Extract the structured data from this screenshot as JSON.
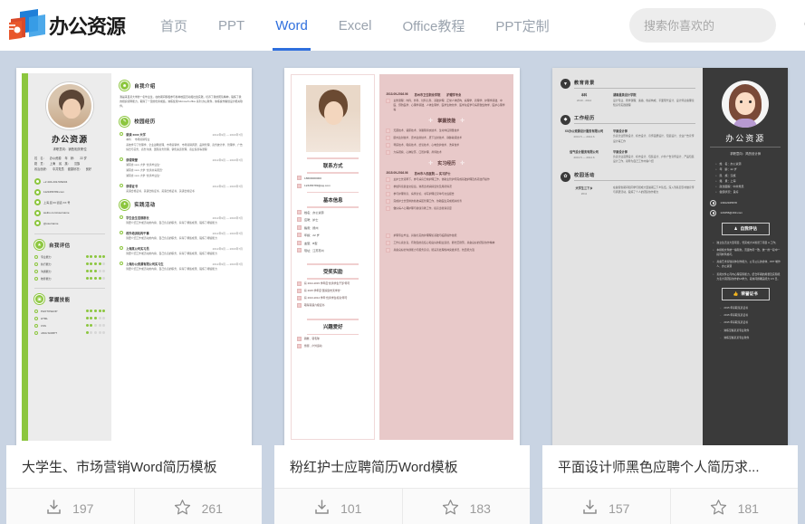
{
  "header": {
    "logo_text": "办公资源",
    "nav": [
      {
        "label": "首页",
        "active": false
      },
      {
        "label": "PPT",
        "active": false
      },
      {
        "label": "Word",
        "active": true
      },
      {
        "label": "Excel",
        "active": false
      },
      {
        "label": "Office教程",
        "active": false
      },
      {
        "label": "PPT定制",
        "active": false
      }
    ],
    "search": {
      "placeholder": "搜索你喜欢的",
      "value": "",
      "icon": "search-icon"
    },
    "accent_color": "#2f6fdd",
    "nav_inactive_color": "#9aa3ae"
  },
  "cards": [
    {
      "title": "大学生、市场营销Word简历模板",
      "downloads": "197",
      "favorites": "261",
      "download_icon": "download-icon",
      "favorite_icon": "star-icon"
    },
    {
      "title": "粉红护士应聘简历Word模板",
      "downloads": "101",
      "favorites": "183",
      "download_icon": "download-icon",
      "favorite_icon": "star-icon"
    },
    {
      "title": "平面设计师黑色应聘个人简历求...",
      "downloads": "157",
      "favorites": "181",
      "download_icon": "download-icon",
      "favorite_icon": "star-icon"
    }
  ],
  "resume1": {
    "accent_color": "#8cc63e",
    "name": "办公资源",
    "objective": "求职意向：销售相关职位",
    "info": [
      {
        "k": "姓　名：",
        "v": "办公资源"
      },
      {
        "k": "年　龄：",
        "v": "22 岁"
      },
      {
        "k": "籍　贯：",
        "v": "上海"
      },
      {
        "k": "民　族：",
        "v": "汉族"
      },
      {
        "k": "政治面貌：",
        "v": "中共党员"
      },
      {
        "k": "健康状况：",
        "v": "良好"
      }
    ],
    "contacts": [
      "+2 434-232-539234",
      "1123456789.com",
      "上海,区XX 街道 XX 号",
      "weibo.com/username",
      "@username"
    ],
    "sections": {
      "intro_title": "自我介绍",
      "intro_text": "我是来自某大学的一名毕业生，在校期间积极参与各种校园活动和社会实践，培养了我的团队精神，锻炼了我的组织领导能力，取得了一定的优秀成绩，熟练使用 Microsoft office 系列 办公软件，熟练操作策划设计相关软件。",
      "campus_title": "校园经历",
      "campus": [
        {
          "org": "就读 xxxx 大学",
          "date": "2012年9月 — 2016年7月",
          "major": "本科",
          "major2": "市场营销专业",
          "desc": "系统学习了管理学、企业战略管理、市场营销学、市场营销调研、品牌管理、商务统计学、管理学、广告综合与实务、商务沟通、国际商务管理、销售渠道管理、商业贸易等课程"
        },
        {
          "org": "获得荣誉",
          "date": "2012年9月 — 2016年7月",
          "list": [
            "湖南省 xxxx 大学 “优秀毕业生”",
            "湖南省 xxxx 大学 “优秀共青团员”",
            "湖南省 xxxx 大学 “优秀毕业生”"
          ]
        },
        {
          "org": "获得证书",
          "date": "2012年9月 — 2016年7月",
          "list": [
            "英语合格证书、英语合格证书、英语合格证书、英语合格证书"
          ]
        }
      ],
      "activity_title": "实践活动",
      "activities": [
        {
          "t": "学生会生活部部长",
          "d": "2012年9月 — 2016年7月",
          "p": "简要介绍工作或活动的内容、自己负责的职务、获得了哪些成果、锻炼了哪些能力"
        },
        {
          "t": "校外培训机构干事",
          "d": "2012年9月 — 2016年7月",
          "p": "简要介绍工作或活动的内容、自己负责的职务、获得了哪些成果、锻炼了哪些能力"
        },
        {
          "t": "上海某公司实习员",
          "d": "2012年9月 — 2016年7月",
          "p": "简要介绍工作或活动的内容、自己负责的职务、获得了哪些成果、锻炼了哪些能力"
        },
        {
          "t": "上海办公资源有限公司实习生",
          "d": "2012年9月 — 2016年7月",
          "p": "简要介绍工作或活动的内容、自己负责的职务、获得了哪些成果、锻炼了哪些能力"
        }
      ],
      "assess_title": "自我评估",
      "assess": [
        {
          "label": "专业能力",
          "level": 5
        },
        {
          "label": "执行能力",
          "level": 4
        },
        {
          "label": "沟通能力",
          "level": 3
        },
        {
          "label": "统筹能力",
          "level": 4
        }
      ],
      "skill_title": "掌握技能",
      "skills": [
        {
          "label": "PHOTOSHOP",
          "level": 5
        },
        {
          "label": "HTML",
          "level": 3
        },
        {
          "label": "CSS",
          "level": 2
        },
        {
          "label": "JAVA SCRIPT",
          "level": 1
        }
      ]
    }
  },
  "resume2": {
    "accent_color": "#e8c9c9",
    "contact_title": "联系方式",
    "contacts": [
      "18600000000",
      "123456789@qq.com"
    ],
    "basic_title": "基本信息",
    "basic": [
      "姓名：办公资源",
      "应聘：护士",
      "籍贯：扬州",
      "年龄：22 岁",
      "血型：B型",
      "现址：江苏苏州"
    ],
    "award_title": "受奖实励",
    "awards": [
      "获 2014-2015 学年度“优秀学生干部”称号",
      "获 2015 学年度“国家励志奖学金”",
      "获 2013-2014 学年“优秀学生标兵”称号",
      "取得英语六级证书"
    ],
    "hobby_title": "兴趣爱好",
    "hobbies": [
      "跳舞、羽毛球",
      "旅游、户外运动"
    ],
    "edu_title": "教育背景",
    "edu_head": [
      "2013.09-2016.06",
      "苏州市卫生职业学院",
      "护理学专业"
    ],
    "edu_text": "主修课程：内科、外科、妇科儿科、基础护理、正常人体结构、病理学、药理学、护理学基础、中医、预防医学、心理学基础、人体生理学、医学生物化学、医学免疫学与病原微生物学、医护心理学等",
    "skill_title": "掌握技能",
    "skills": [
      "无菌技术、铺床技术、穿脱隔离衣技术、生命体征测量技术",
      "肌内注射技术、皮内注射技术、皮下注射技术、静脉输液技术",
      "导尿技术、吸痰技术、给氧技术、心电监护技术、洗胃技术",
      "大病观察、心肺复苏、口腔护理、鼻饲技术"
    ],
    "intern_title": "实习经历",
    "intern_head": [
      "2015.09-2016.06",
      "苏州市人民医院 — 实习护士"
    ],
    "intern_items": [
      "主护士长领导下，参与病房日常护理工作，协助主管护师完成基础护理及各项治疗操作",
      "参加科室晨会交接班，熟悉患者病情变化及用药情况",
      "参与护理查房、病例讨论，书写护理记录单与交班报告",
      "完成护士长安排的各类病区管理工作，协助医生完成相关检查",
      "做好病人心理护理与健康宣教工作，提高患者满意度"
    ],
    "summary_items": [
      "护理专业毕业，具备扎实的护理理论基础与临床操作技能",
      "工作认真负责，有较强的责任心和良好的职业道德，能吃苦耐劳，具备良好的团队协作精神",
      "具备良好的沟通能力与服务意识，能妥善处理各种突发状况，抗压能力强"
    ]
  },
  "resume3": {
    "accent_color": "#3a3a3a",
    "name": "办公资源",
    "objective": "求职意向：简历设计师",
    "info": [
      "姓　名：办公资源",
      "年　龄：22 岁",
      "民　族：汉族",
      "籍　贯：上海",
      "政治面貌：中共党员",
      "健康状况：良好"
    ],
    "contacts": [
      "13912345678",
      "123456@163.com"
    ],
    "edu_title": "教育背景",
    "edu": [
      {
        "m1": "本科",
        "m2": "2010 - 2014",
        "h": "湖南星美设计学院",
        "p": "设计专业、所学课程：素描、色彩构成、平面现代设计、设计师必备理论知识与实践课程"
      }
    ],
    "work_title": "工作经历",
    "work": [
      {
        "m1": "XX办公资源设计服务有限公司",
        "m2": "2013.5 — 2014.6",
        "h": "平面设计师",
        "p": "负责企业形象设计、标志设计、宣传画册设计、包装设计、企业广告宣传设计等工作"
      },
      {
        "m1": "信气设计服务有限公司",
        "m2": "2013.5 — 2014.6",
        "h": "平面设计师",
        "p": "负责企业画册设计、标志设计、包装设计、户外广告宣传设计、产品包装设计工作，领导为自己工作内容介绍"
      }
    ],
    "campus_title": "校园活动",
    "campus": [
      {
        "m1": "大学生三下乡",
        "m2": "2011",
        "h": "",
        "p": "在暑假省期间和同学们组成大型暑期三下乡队伍，深入到基层农村做宣传与调研活动，锻炼了个人的团队协作能力"
      }
    ],
    "assess_btn": "自我评估",
    "assess": [
      "独立生活过大型项目，曾完成大众脸谱了项目 A 工作；",
      "本模板文件统一编辑色，页面布局一致，统一的一段中一段同样风格可。",
      "具备艺术家较具体创作能力、公司公认的省体、PPT 制作人、办公资源",
      "善用文件公司内心理实际能力，结合年期的用量及实际能力表大项团队协作的UI学力，段熟问题覆盖能力 0.5 日。"
    ],
    "cert_btn": "荣誉证书",
    "certs": [
      "2015 年获取某某证书",
      "2015 年获取某某证书",
      "2015 年获取某某证书",
      "熟练掌握某某专业软件",
      "熟练掌握某某专业软件"
    ]
  }
}
